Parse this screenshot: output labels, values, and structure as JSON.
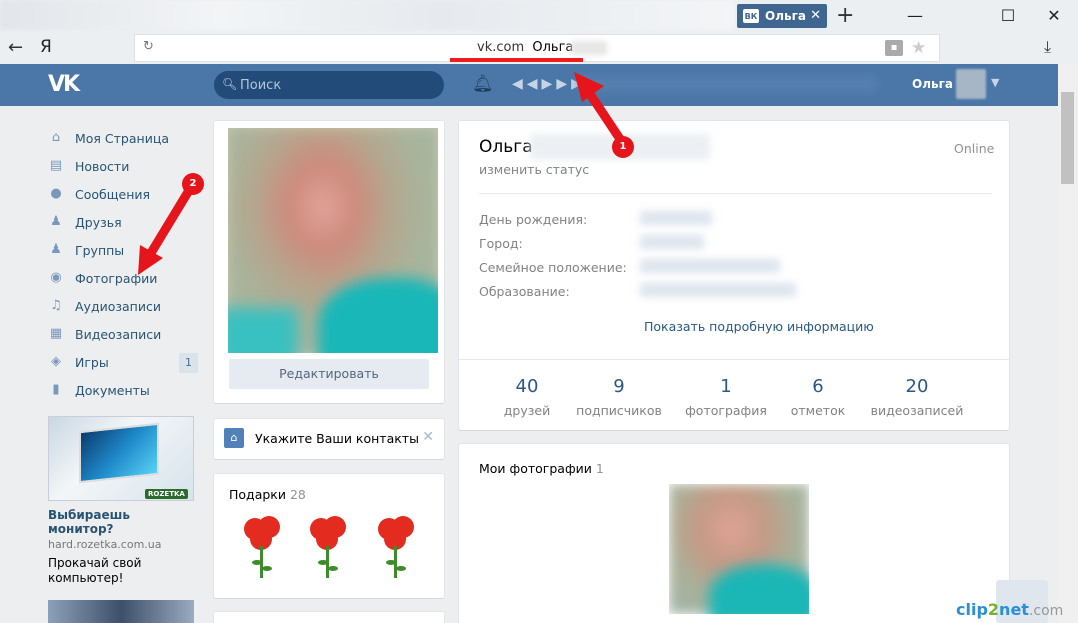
{
  "browser": {
    "tab_title": "Ольга",
    "tab_icon": "ВК",
    "close_tab": "✕",
    "new_tab": "+",
    "back": "←",
    "home_logo": "Я",
    "url_domain": "vk.com",
    "url_page": "Ольга",
    "minimize": "—",
    "maximize": "☐",
    "close": "✕"
  },
  "header": {
    "logo": "VK",
    "search_placeholder": "Поиск",
    "user_name": "Ольга"
  },
  "menu": {
    "items": [
      {
        "label": "Моя Страница",
        "icon": "home-icon"
      },
      {
        "label": "Новости",
        "icon": "news-icon"
      },
      {
        "label": "Сообщения",
        "icon": "messages-icon"
      },
      {
        "label": "Друзья",
        "icon": "friends-icon"
      },
      {
        "label": "Группы",
        "icon": "groups-icon"
      },
      {
        "label": "Фотографии",
        "icon": "camera-icon"
      },
      {
        "label": "Аудиозаписи",
        "icon": "music-icon"
      },
      {
        "label": "Видеозаписи",
        "icon": "video-icon"
      },
      {
        "label": "Игры",
        "icon": "gamepad-icon",
        "count": "1"
      },
      {
        "label": "Документы",
        "icon": "document-icon"
      }
    ]
  },
  "ad": {
    "brand": "ROZETKA",
    "title": "Выбираешь монитор?",
    "domain": "hard.rozetka.com.ua",
    "text": "Прокачай свой компьютер!"
  },
  "left_column": {
    "edit_button": "Редактировать",
    "contacts_prompt": "Укажите Ваши контакты",
    "gifts_title": "Подарки",
    "gifts_count": "28"
  },
  "profile": {
    "name": "Ольга",
    "status_link": "изменить статус",
    "online": "Online",
    "fields": [
      {
        "label": "День рождения:"
      },
      {
        "label": "Город:"
      },
      {
        "label": "Семейное положение:"
      },
      {
        "label": "Образование:"
      }
    ],
    "show_more": "Показать подробную информацию",
    "counters": [
      {
        "number": "40",
        "label": "друзей"
      },
      {
        "number": "9",
        "label": "подписчиков"
      },
      {
        "number": "1",
        "label": "фотография"
      },
      {
        "number": "6",
        "label": "отметок"
      },
      {
        "number": "20",
        "label": "видеозаписей"
      }
    ],
    "photos_title": "Мои фотографии",
    "photos_count": "1"
  },
  "annotations": {
    "badge1": "1",
    "badge2": "2",
    "color": "#e6141b"
  },
  "watermark": {
    "a": "clip",
    "b": "2",
    "c": "net",
    "d": ".com"
  }
}
